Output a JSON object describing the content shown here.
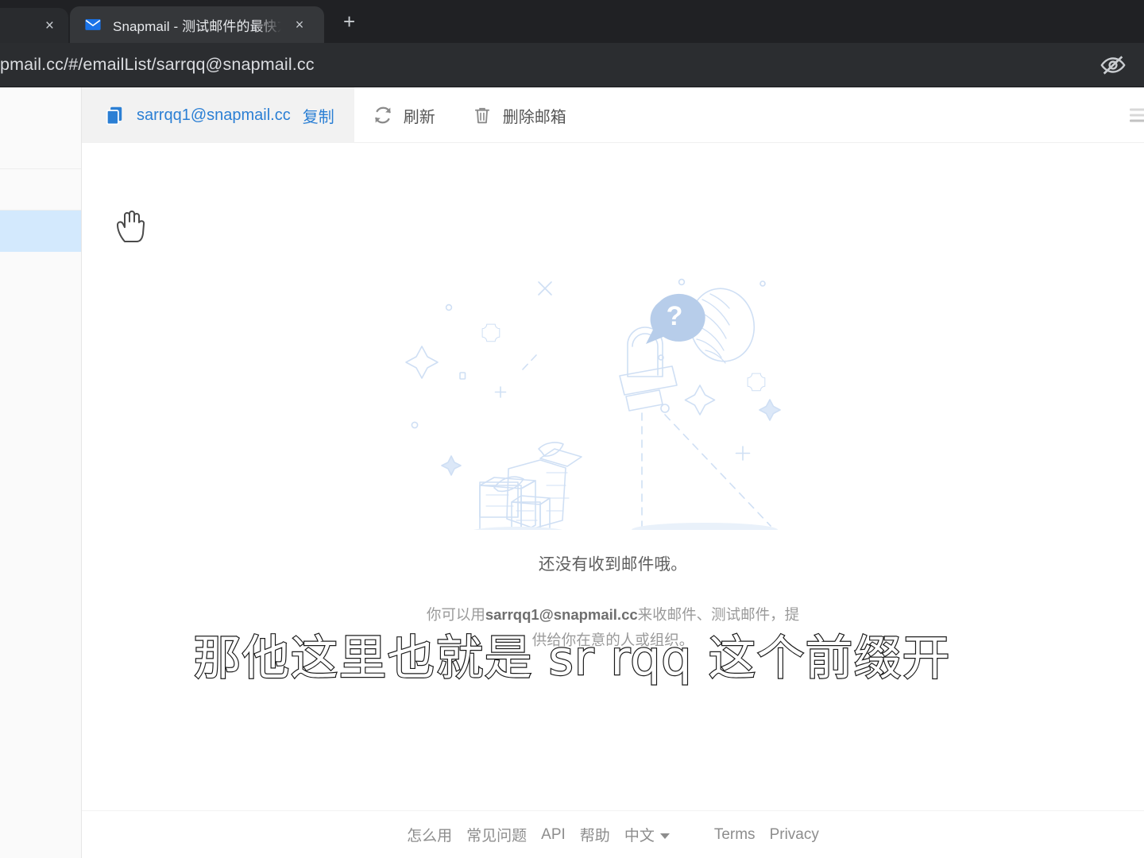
{
  "browser": {
    "left_tab": {
      "close_label": "×"
    },
    "tab": {
      "title": "Snapmail - 测试邮件的最快方法",
      "favicon": "envelope-icon",
      "close_label": "×"
    },
    "new_tab_label": "+",
    "omnibox": {
      "url": "pmail.cc/#/emailList/sarrqq@snapmail.cc",
      "right_icon": "eye-slash-icon"
    }
  },
  "toolbar": {
    "copy": {
      "icon": "copy-icon",
      "address": "sarrqq1@snapmail.cc",
      "action_label": "复制"
    },
    "refresh": {
      "icon": "refresh-icon",
      "label": "刷新"
    },
    "delete": {
      "icon": "trash-icon",
      "label": "删除邮箱"
    },
    "menu_icon": "hamburger-menu-icon"
  },
  "sidebar": {
    "rows": [
      {
        "selected": false
      },
      {
        "selected": false
      },
      {
        "selected": true
      },
      {
        "selected": false
      }
    ]
  },
  "empty_state": {
    "illustration": "spotlight-searching-illustration",
    "title": "还没有收到邮件哦。",
    "desc_prefix": "你可以用",
    "desc_address": "sarrqq1@snapmail.cc",
    "desc_suffix": "来收邮件、测试邮件，提",
    "desc_line2": "供给你在意的人或组织。"
  },
  "footer": {
    "links": [
      {
        "label": "怎么用"
      },
      {
        "label": "常见问题"
      },
      {
        "label": "API"
      },
      {
        "label": "帮助"
      },
      {
        "label": "中文",
        "caret": true
      }
    ],
    "right_links": [
      {
        "label": "Terms"
      },
      {
        "label": "Privacy"
      }
    ]
  },
  "subtitle": {
    "text": "那他这里也就是 sr rqq 这个前缀开"
  },
  "colors": {
    "accent_blue": "#2b7fd4",
    "selected_row": "#d3e9fd",
    "chrome_dark": "#202124",
    "illustration_blue": "#c7daf2"
  }
}
